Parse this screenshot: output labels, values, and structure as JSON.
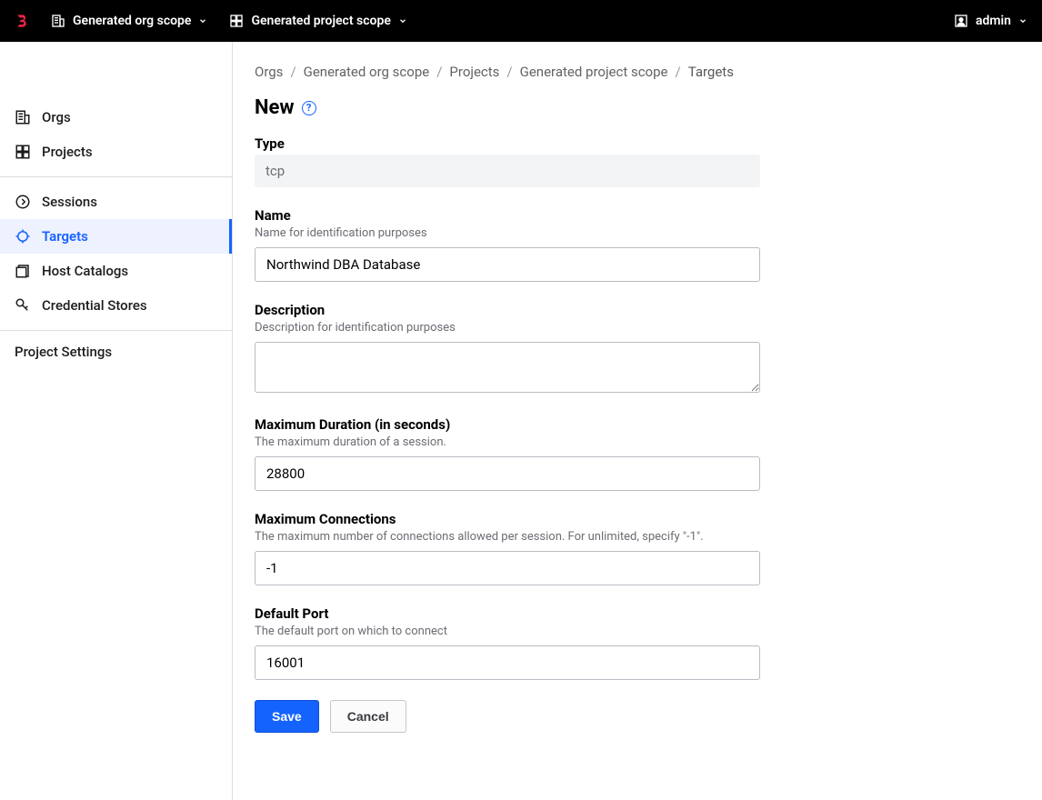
{
  "topbar": {
    "org_scope_label": "Generated org scope",
    "project_scope_label": "Generated project scope",
    "user_label": "admin"
  },
  "sidebar": {
    "orgs_label": "Orgs",
    "projects_label": "Projects",
    "sessions_label": "Sessions",
    "targets_label": "Targets",
    "host_catalogs_label": "Host Catalogs",
    "credential_stores_label": "Credential Stores",
    "project_settings_label": "Project Settings"
  },
  "breadcrumbs": {
    "orgs": "Orgs",
    "org_scope": "Generated org scope",
    "projects": "Projects",
    "project_scope": "Generated project scope",
    "targets": "Targets"
  },
  "page": {
    "title": "New",
    "help_char": "?"
  },
  "form": {
    "type": {
      "label": "Type",
      "value": "tcp"
    },
    "name": {
      "label": "Name",
      "help": "Name for identification purposes",
      "value": "Northwind DBA Database"
    },
    "description": {
      "label": "Description",
      "help": "Description for identification purposes",
      "value": ""
    },
    "max_duration": {
      "label": "Maximum Duration (in seconds)",
      "help": "The maximum duration of a session.",
      "value": "28800"
    },
    "max_connections": {
      "label": "Maximum Connections",
      "help": "The maximum number of connections allowed per session. For unlimited, specify \"-1\".",
      "value": "-1"
    },
    "default_port": {
      "label": "Default Port",
      "help": "The default port on which to connect",
      "value": "16001"
    },
    "save_label": "Save",
    "cancel_label": "Cancel"
  }
}
